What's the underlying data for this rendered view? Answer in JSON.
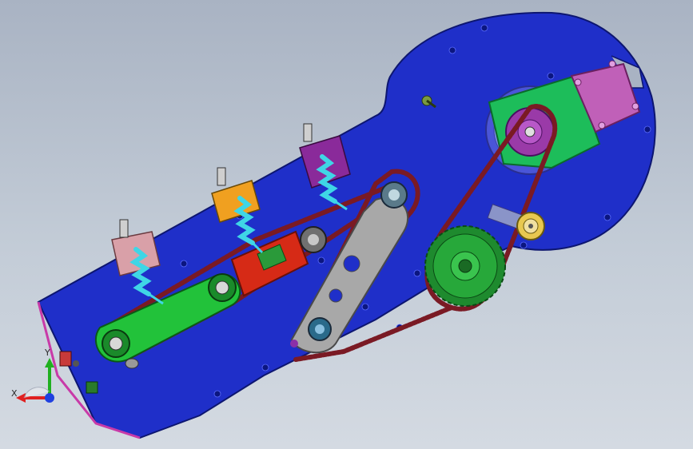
{
  "colors": {
    "background_top": "#a9b3c3",
    "background_bottom": "#d4dae2",
    "base_plate": "#1f2fc9",
    "plate_edge": "#0d1670",
    "chain": "#7a1a24",
    "link_arm": "#22c23a",
    "gray_arm": "#a8a8a8",
    "large_gear": "#27a83a",
    "motor_housing": "#1dbd5a",
    "motor_mount": "#c060b8",
    "red_slider": "#d62a16",
    "spring": "#3fd6e6",
    "clamp_pink": "#d9a0a8",
    "clamp_orange": "#f0a020",
    "clamp_purple": "#8a2a9a"
  },
  "view_triad": {
    "x_label": "X",
    "y_label": "Y",
    "x_axis_color": "#e02020",
    "y_axis_color": "#20b020",
    "z_axis_color": "#2040e0"
  },
  "icons": [
    "view-triad-icon"
  ]
}
